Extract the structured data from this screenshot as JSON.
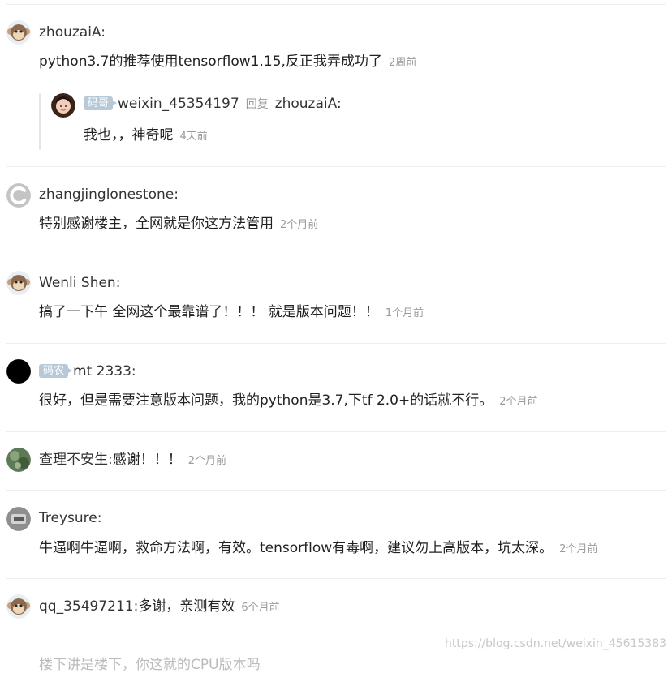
{
  "comments": [
    {
      "user": "zhouzaiA",
      "colon": ":",
      "text": "python3.7的推荐使用tensorflow1.15,反正我弄成功了",
      "time": "2周前",
      "reply": {
        "badge": "码哥",
        "user": "weixin_45354197",
        "reply_word": "回复",
        "target": "zhouzaiA",
        "colon": ":",
        "text": "我也，，神奇呢",
        "time": "4天前"
      }
    },
    {
      "user": "zhangjinglonestone",
      "colon": ":",
      "text": "特别感谢楼主，全网就是你这方法管用",
      "time": "2个月前"
    },
    {
      "user": "Wenli Shen",
      "colon": ":",
      "text": "搞了一下午 全网这个最靠谱了！！！ 就是版本问题！！",
      "time": "1个月前"
    },
    {
      "badge": "码农",
      "user": "mt 2333",
      "colon": ":",
      "text": "很好，但是需要注意版本问题，我的python是3.7,下tf 2.0+的话就不行。",
      "time": "2个月前"
    },
    {
      "user": "查理不安生",
      "colon": ":",
      "text": "感谢！！！",
      "time": "2个月前"
    },
    {
      "user": "Treysure",
      "colon": ":",
      "text": "牛逼啊牛逼啊，救命方法啊，有效。tensorflow有毒啊，建议勿上高版本，坑太深。",
      "time": "2个月前"
    },
    {
      "user": "qq_35497211",
      "colon": ":",
      "text": "多谢，亲测有效",
      "time": "6个月前"
    }
  ],
  "partial_next_comment": "楼下讲是楼下，你这就的CPU版本吗",
  "watermark": "https://blog.csdn.net/weixin_45615383",
  "colors": {
    "name": "#333333",
    "time": "#999999",
    "badge_bg": "#b7c9d8",
    "divider": "#eeeeee"
  },
  "icons": [
    "monkey-avatar-icon",
    "csdn-c-logo-icon",
    "black-circle-avatar-icon",
    "photo-avatar-icon"
  ]
}
